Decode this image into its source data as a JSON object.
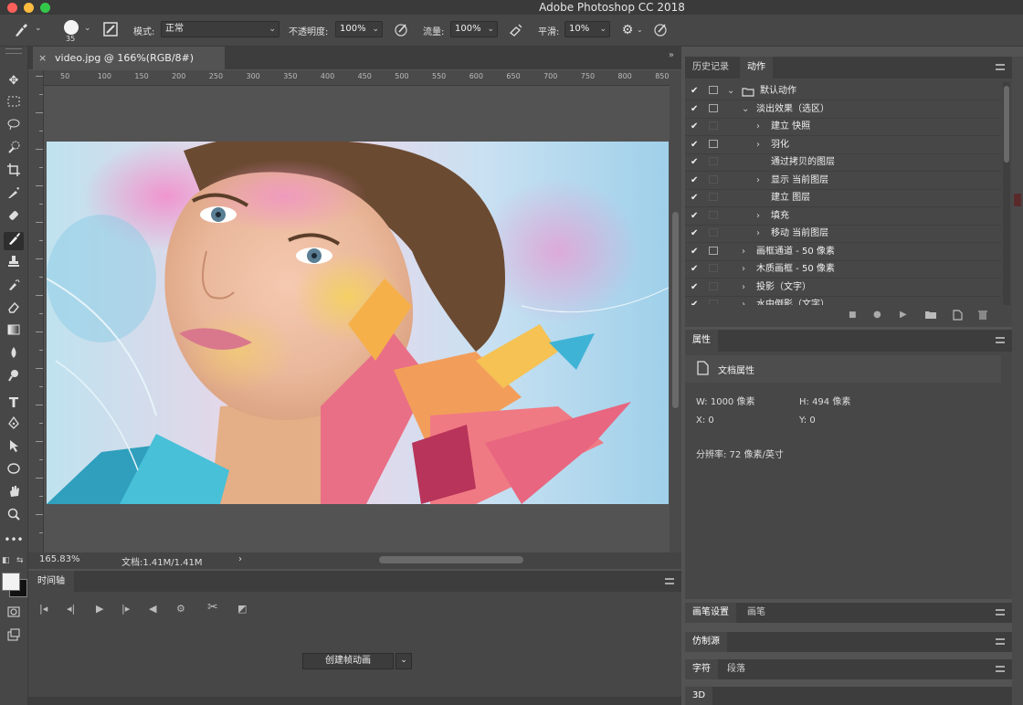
{
  "app": {
    "title": "Adobe Photoshop CC 2018"
  },
  "options": {
    "brush_size": "35",
    "mode_label": "模式:",
    "mode_value": "正常",
    "opacity_label": "不透明度:",
    "opacity_value": "100%",
    "flow_label": "流量:",
    "flow_value": "100%",
    "smooth_label": "平滑:",
    "smooth_value": "10%"
  },
  "document": {
    "tab_title": "video.jpg @ 166%(RGB/8#)"
  },
  "ruler": {
    "marks": [
      "50",
      "100",
      "150",
      "200",
      "250",
      "300",
      "350",
      "400",
      "450",
      "500",
      "550",
      "600",
      "650",
      "700",
      "750",
      "800",
      "850"
    ]
  },
  "status": {
    "zoom": "165.83%",
    "doc_info": "文档:1.41M/1.41M"
  },
  "timeline": {
    "tab": "时间轴",
    "create_button": "创建帧动画"
  },
  "panels": {
    "history_tab": "历史记录",
    "actions_tab": "动作",
    "actions": [
      {
        "label": "默认动作",
        "level": 0,
        "expand": "open",
        "folder": true,
        "dialog": true
      },
      {
        "label": "淡出效果（选区）",
        "level": 1,
        "expand": "open",
        "folder": false,
        "dialog": true
      },
      {
        "label": "建立 快照",
        "level": 2,
        "expand": "closed",
        "folder": false,
        "dialog": false
      },
      {
        "label": "羽化",
        "level": 2,
        "expand": "closed",
        "folder": false,
        "dialog": true
      },
      {
        "label": "通过拷贝的图层",
        "level": 2,
        "expand": "none",
        "folder": false,
        "dialog": false
      },
      {
        "label": "显示 当前图层",
        "level": 2,
        "expand": "closed",
        "folder": false,
        "dialog": false
      },
      {
        "label": "建立 图层",
        "level": 2,
        "expand": "none",
        "folder": false,
        "dialog": false
      },
      {
        "label": "填充",
        "level": 2,
        "expand": "closed",
        "folder": false,
        "dialog": false
      },
      {
        "label": "移动 当前图层",
        "level": 2,
        "expand": "closed",
        "folder": false,
        "dialog": false
      },
      {
        "label": "画框通道 - 50 像素",
        "level": 1,
        "expand": "closed",
        "folder": false,
        "dialog": true
      },
      {
        "label": "木质画框 - 50 像素",
        "level": 1,
        "expand": "closed",
        "folder": false,
        "dialog": false
      },
      {
        "label": "投影（文字）",
        "level": 1,
        "expand": "closed",
        "folder": false,
        "dialog": false
      },
      {
        "label": "水中倒影（文字）",
        "level": 1,
        "expand": "closed",
        "folder": false,
        "dialog": false
      }
    ],
    "properties_tab": "属性",
    "doc_props_title": "文档属性",
    "width": "W: 1000 像素",
    "height": "H: 494 像素",
    "x": "X: 0",
    "y": "Y: 0",
    "resolution": "分辨率: 72 像素/英寸",
    "brush_settings_tab": "画笔设置",
    "brush_tab": "画笔",
    "clone_source_tab": "仿制源",
    "character_tab": "字符",
    "paragraph_tab": "段落",
    "threed_tab": "3D"
  },
  "colors": {
    "accent": "#4aa3df",
    "bg": "#535353"
  }
}
